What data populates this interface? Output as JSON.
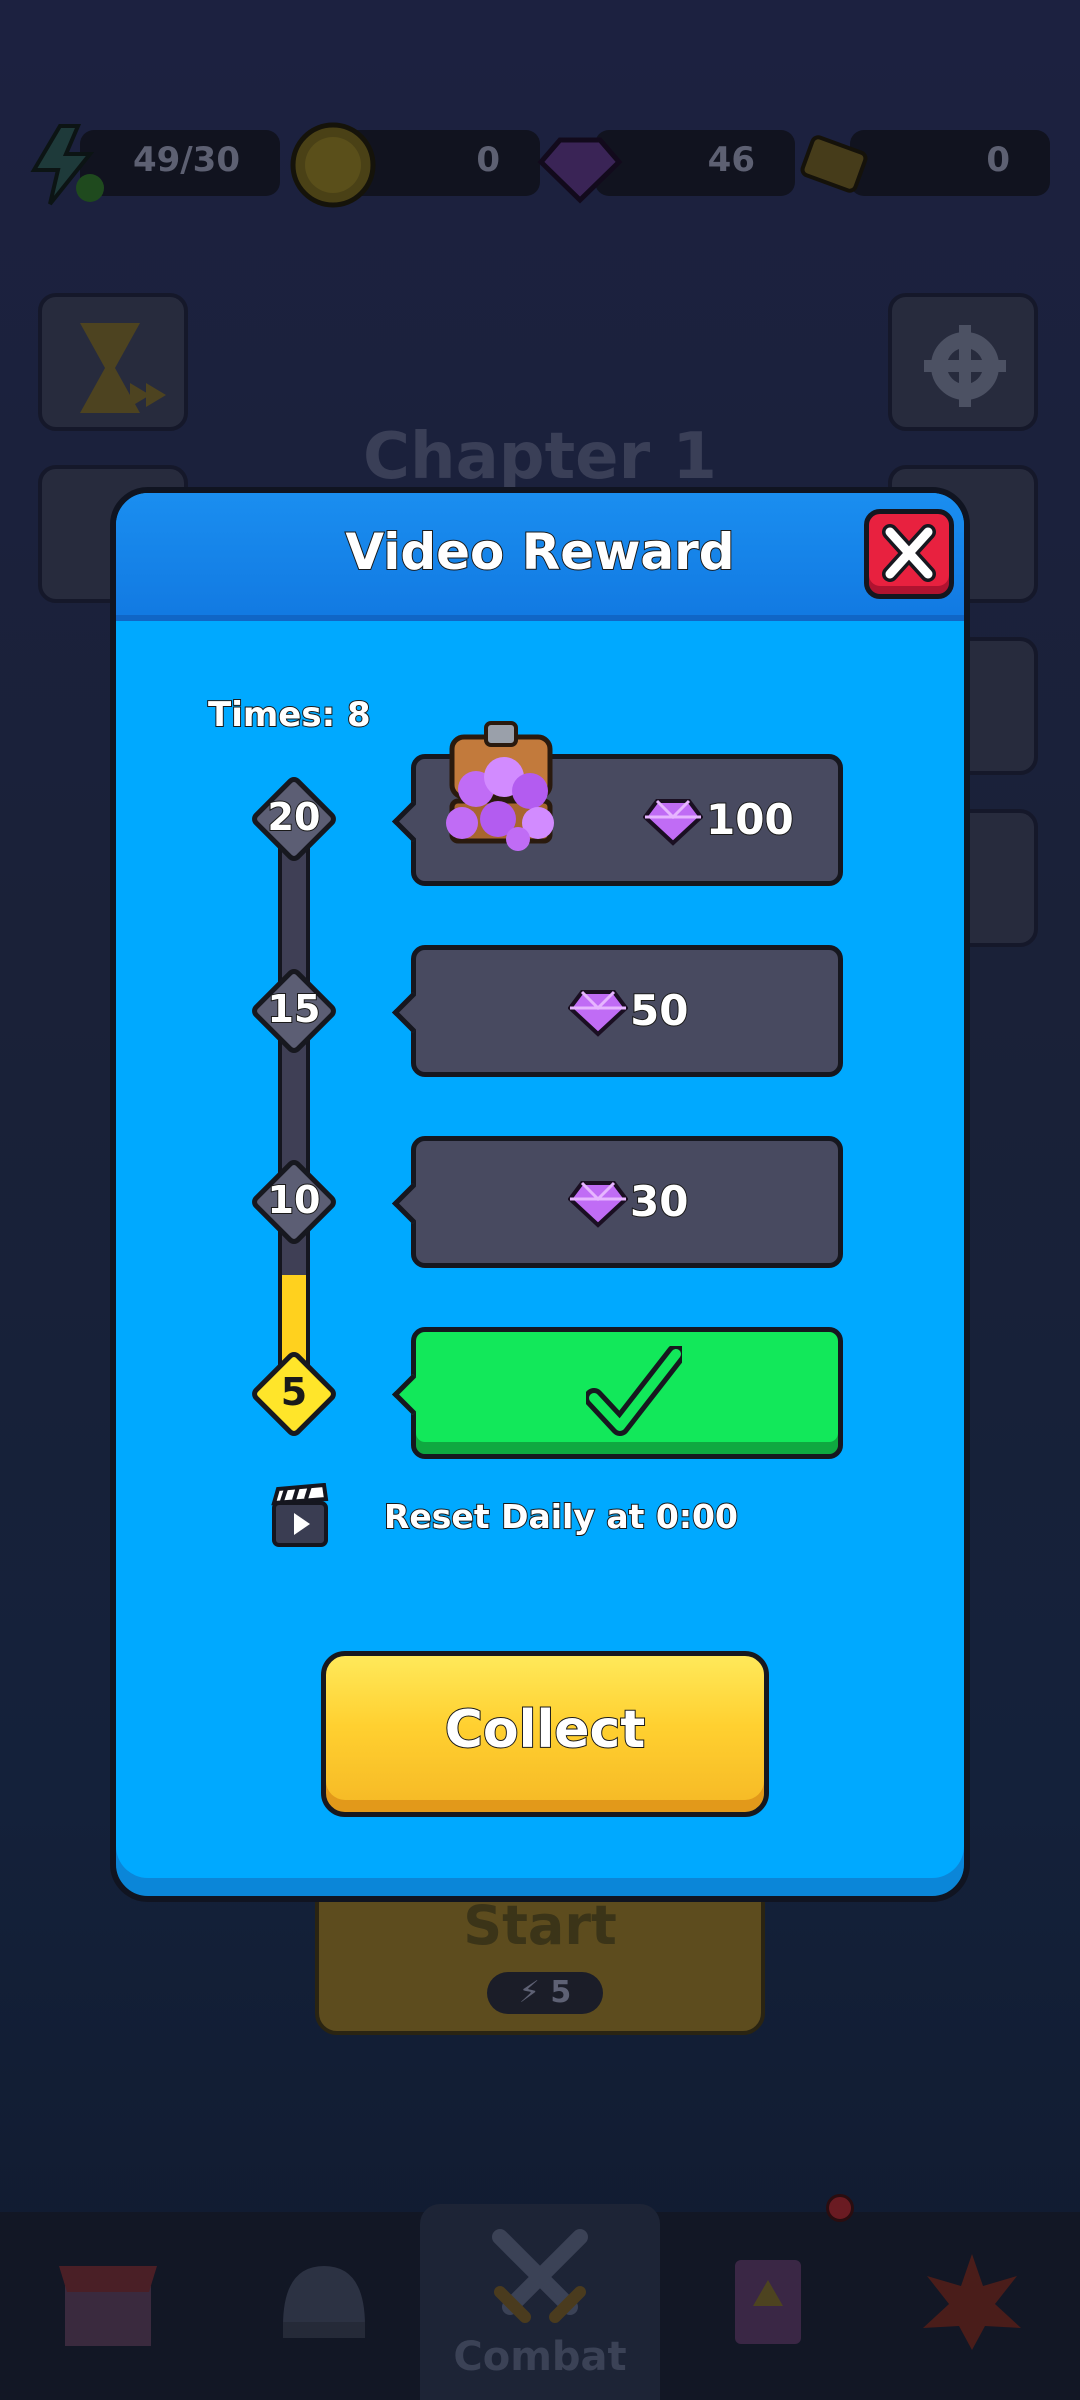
{
  "resources": {
    "energy": "49/30",
    "coins": "0",
    "gems": "46",
    "tickets": "0"
  },
  "background": {
    "chapter_title": "Chapter 1",
    "start_label": "Start",
    "start_cost": "5"
  },
  "bottom_nav": {
    "combat_label": "Combat"
  },
  "dialog": {
    "title": "Video Reward",
    "times_label": "Times: 8",
    "milestones": [
      "20",
      "15",
      "10",
      "5"
    ],
    "rewards": [
      {
        "threshold": "20",
        "amount": "100",
        "icon": "gem-chest-icon",
        "claimed": false
      },
      {
        "threshold": "15",
        "amount": "50",
        "icon": "gem-icon",
        "claimed": false
      },
      {
        "threshold": "10",
        "amount": "30",
        "icon": "gem-icon",
        "claimed": false
      },
      {
        "threshold": "5",
        "icon": "checkmark-icon",
        "claimed": true
      }
    ],
    "progress_fraction": 0.4,
    "reset_text": "Reset Daily at 0:00",
    "collect_label": "Collect"
  },
  "colors": {
    "dialog_bg": "#00a9ff",
    "header_bg": "#127ae2",
    "claimed_green": "#12e85a",
    "collect_yellow": "#ffd030",
    "close_red": "#e8213f",
    "gem_purple": "#b35cf0"
  }
}
